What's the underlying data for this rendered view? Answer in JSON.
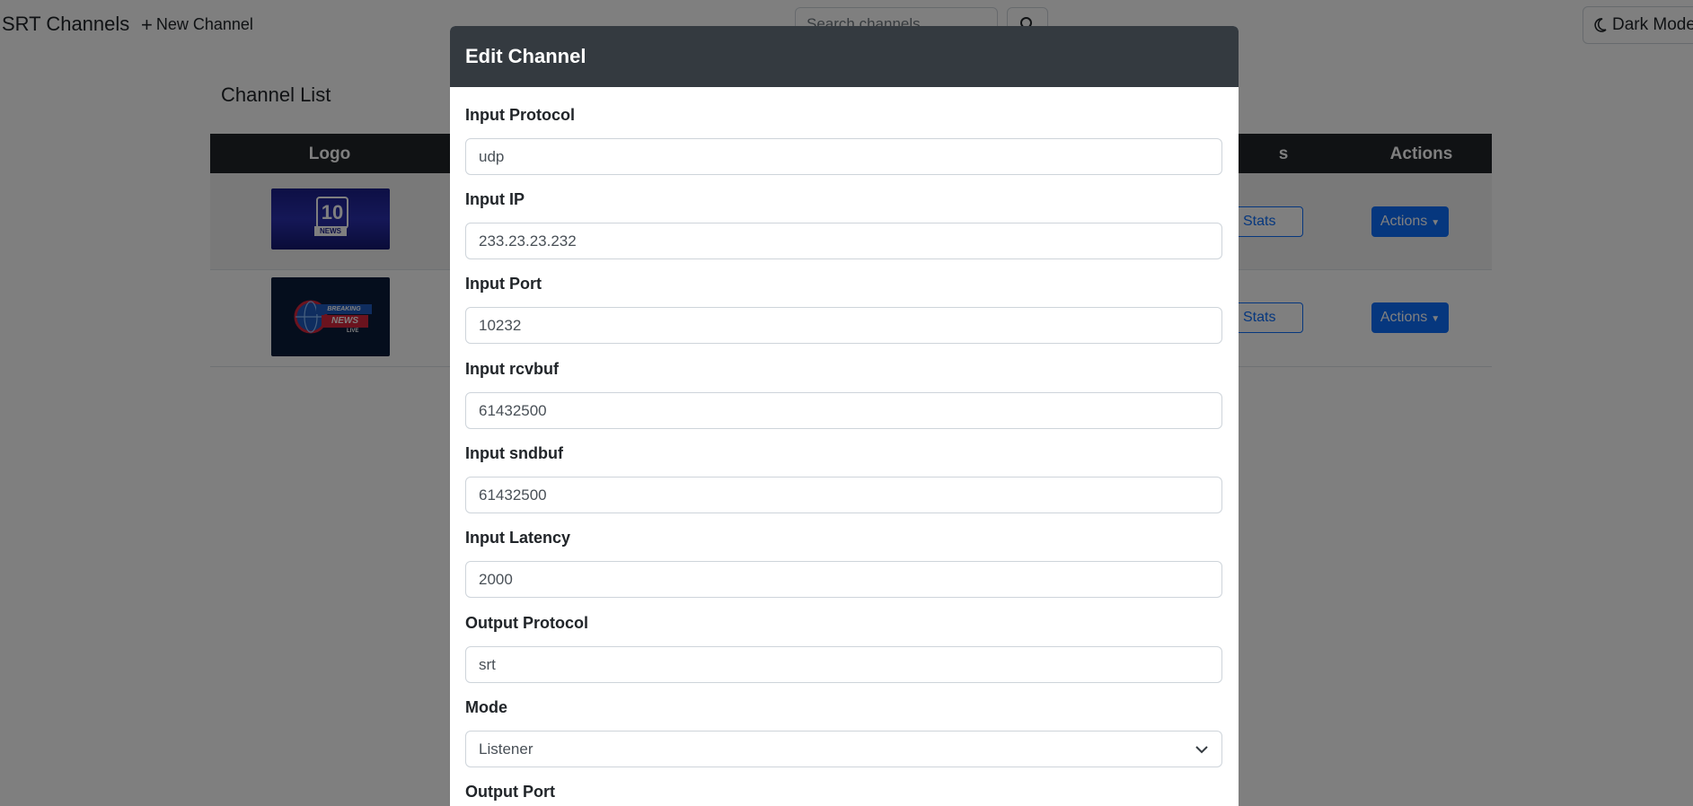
{
  "navbar": {
    "brand": "SRT Channels",
    "new_channel_label": "New Channel",
    "search_placeholder": "Search channels...",
    "dark_mode_label": "Dark Mode"
  },
  "channel_list": {
    "title": "Channel List",
    "columns": {
      "logo": "Logo",
      "stats": "s",
      "actions": "Actions"
    },
    "rows": [
      {
        "logo_text_top": "10",
        "logo_text_bottom": "NEWS",
        "stats_label": "Stats",
        "actions_label": "Actions"
      },
      {
        "logo_text_top": "BREAKING",
        "logo_text_bottom": "NEWS",
        "logo_text_small": "LIVE",
        "stats_label": "Stats",
        "actions_label": "Actions"
      }
    ]
  },
  "modal": {
    "title": "Edit Channel",
    "fields": [
      {
        "label": "Input Protocol",
        "value": "udp"
      },
      {
        "label": "Input IP",
        "value": "233.23.23.232"
      },
      {
        "label": "Input Port",
        "value": "10232"
      },
      {
        "label": "Input rcvbuf",
        "value": "61432500"
      },
      {
        "label": "Input sndbuf",
        "value": "61432500"
      },
      {
        "label": "Input Latency",
        "value": "2000"
      },
      {
        "label": "Output Protocol",
        "value": "srt"
      },
      {
        "label": "Mode",
        "value": "Listener"
      },
      {
        "label": "Output Port",
        "value": ""
      }
    ]
  },
  "colors": {
    "primary": "#0d6efd",
    "header_dark": "#212529",
    "modal_header": "#343a40"
  },
  "icons": {
    "new_channel": "plus-icon",
    "search": "search-icon",
    "dark_mode": "moon-icon",
    "select": "chevron-down-icon"
  }
}
